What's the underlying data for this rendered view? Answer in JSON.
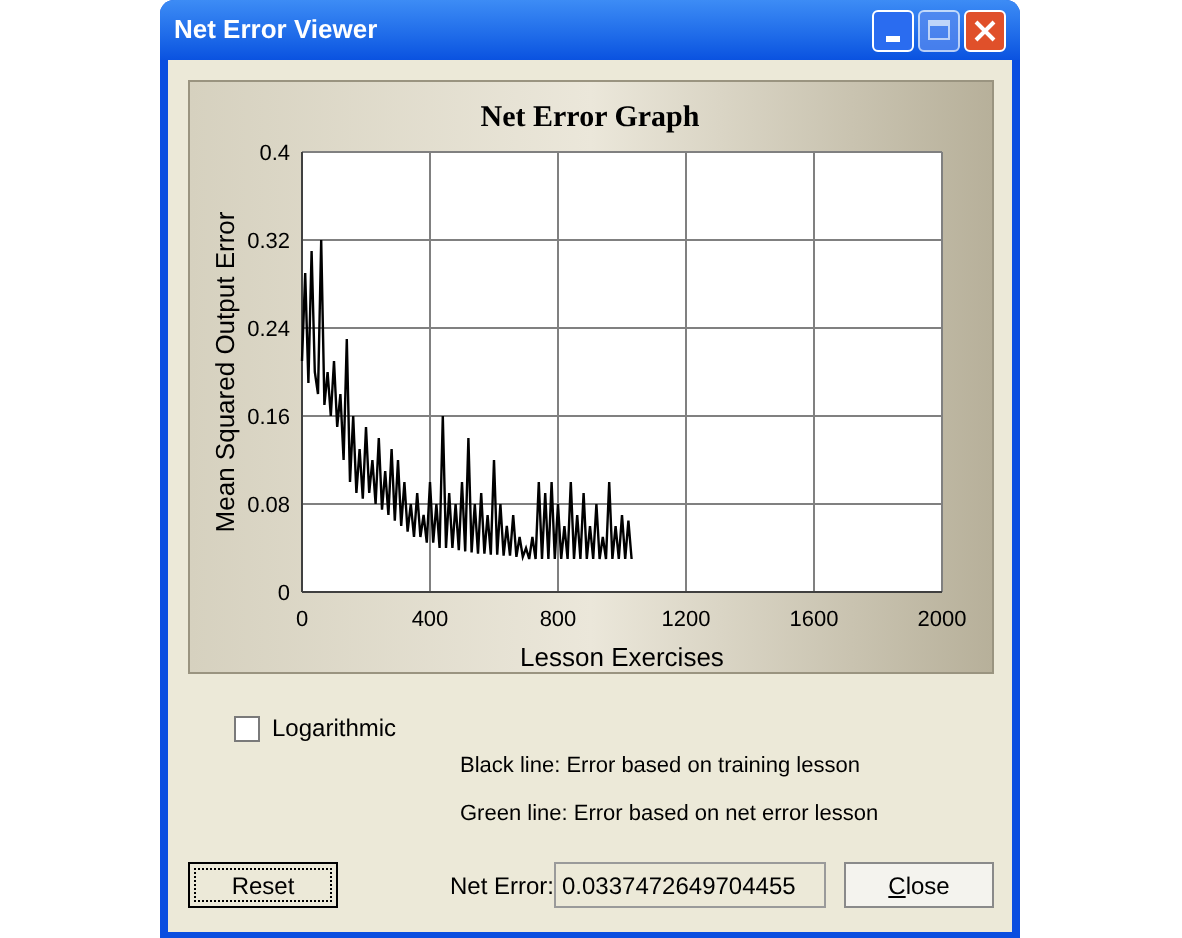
{
  "window": {
    "title": "Net Error Viewer"
  },
  "graph": {
    "chart_data": {
      "type": "line",
      "title": "Net Error Graph",
      "xlabel": "Lesson Exercises",
      "ylabel": "Mean Squared Output Error",
      "x": [
        0,
        10,
        20,
        30,
        40,
        50,
        60,
        70,
        80,
        90,
        100,
        110,
        120,
        130,
        140,
        150,
        160,
        170,
        180,
        190,
        200,
        210,
        220,
        230,
        240,
        250,
        260,
        270,
        280,
        290,
        300,
        310,
        320,
        330,
        340,
        350,
        360,
        370,
        380,
        390,
        400,
        410,
        420,
        430,
        440,
        450,
        460,
        470,
        480,
        490,
        500,
        510,
        520,
        530,
        540,
        550,
        560,
        570,
        580,
        590,
        600,
        610,
        620,
        630,
        640,
        650,
        660,
        670,
        680,
        690,
        700,
        710,
        720,
        730,
        740,
        750,
        760,
        770,
        780,
        790,
        800,
        810,
        820,
        830,
        840,
        850,
        860,
        870,
        880,
        890,
        900,
        910,
        920,
        930,
        940,
        950,
        960,
        970,
        980,
        990,
        1000,
        1010,
        1020,
        1030
      ],
      "grid": true,
      "series": [
        {
          "color": "#000000",
          "values": [
            0.21,
            0.29,
            0.19,
            0.31,
            0.2,
            0.18,
            0.32,
            0.17,
            0.2,
            0.16,
            0.21,
            0.15,
            0.18,
            0.12,
            0.23,
            0.1,
            0.16,
            0.09,
            0.13,
            0.085,
            0.15,
            0.09,
            0.12,
            0.08,
            0.14,
            0.075,
            0.11,
            0.07,
            0.13,
            0.065,
            0.12,
            0.06,
            0.1,
            0.055,
            0.08,
            0.05,
            0.09,
            0.05,
            0.07,
            0.045,
            0.1,
            0.045,
            0.08,
            0.04,
            0.16,
            0.04,
            0.09,
            0.04,
            0.08,
            0.038,
            0.1,
            0.037,
            0.14,
            0.036,
            0.08,
            0.035,
            0.09,
            0.035,
            0.07,
            0.034,
            0.12,
            0.034,
            0.08,
            0.033,
            0.06,
            0.033,
            0.07,
            0.032,
            0.05,
            0.032,
            0.04,
            0.03,
            0.05,
            0.03,
            0.1,
            0.03,
            0.09,
            0.03,
            0.1,
            0.03,
            0.08,
            0.03,
            0.06,
            0.03,
            0.1,
            0.03,
            0.07,
            0.03,
            0.09,
            0.03,
            0.06,
            0.03,
            0.08,
            0.03,
            0.05,
            0.03,
            0.1,
            0.03,
            0.06,
            0.03,
            0.07,
            0.03,
            0.065,
            0.03
          ]
        }
      ],
      "xlim": [
        0,
        2000
      ],
      "ylim": [
        0,
        0.4
      ],
      "xticks": [
        0,
        400,
        800,
        1200,
        1600,
        2000
      ],
      "yticks": [
        0,
        {
          "value": 0.08,
          "label": "0.08"
        },
        {
          "value": 0.16,
          "label": "0.16"
        },
        {
          "value": 0.24,
          "label": "0.24"
        },
        {
          "value": 0.32,
          "label": "0.32"
        },
        {
          "value": 0.4,
          "label": "0.4"
        }
      ]
    }
  },
  "logarithmic": {
    "label": "Logarithmic",
    "checked": false
  },
  "legend": [
    "Black line: Error based on training lesson",
    "Green line: Error based on net error lesson"
  ],
  "buttons": {
    "reset": "Reset",
    "close": "Close"
  },
  "net_error": {
    "label": "Net Error:",
    "value": "0.0337472649704455"
  }
}
